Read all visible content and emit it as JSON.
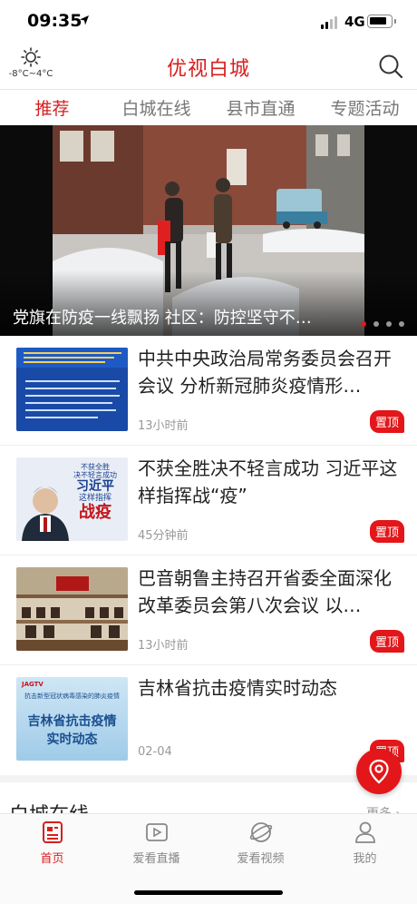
{
  "status_bar": {
    "time": "09:35",
    "network": "4G"
  },
  "header": {
    "weather_temp": "-8°C~4°C",
    "title": "优视白城"
  },
  "tabs": [
    {
      "label": "推荐",
      "active": true
    },
    {
      "label": "白城在线",
      "active": false
    },
    {
      "label": "县市直通",
      "active": false
    },
    {
      "label": "专题活动",
      "active": false
    }
  ],
  "banner": {
    "caption": "党旗在防疫一线飘扬 社区：防控坚守不…",
    "page_count": 4,
    "active_page": 1
  },
  "news": [
    {
      "title": "中共中央政治局常务委员会召开会议 分析新冠肺炎疫情形…",
      "time": "13小时前",
      "badge": "置顶"
    },
    {
      "title": "不获全胜决不轻言成功 习近平这样指挥战“疫”",
      "time": "45分钟前",
      "badge": "置顶"
    },
    {
      "title": "巴音朝鲁主持召开省委全面深化改革委员会第八次会议 以…",
      "time": "13小时前",
      "badge": "置顶"
    },
    {
      "title": "吉林省抗击疫情实时动态",
      "time": "02-04",
      "badge": "置顶"
    }
  ],
  "thumb_text": {
    "t2_line1": "不获全胜",
    "t2_line2": "决不轻言成功",
    "t2_name": "习近平",
    "t2_line3": "这样指挥",
    "t2_big": "战疫",
    "t4_top": "抗击新型冠状病毒感染的肺炎疫情",
    "t4_big1": "吉林省抗击疫情",
    "t4_big2": "实时动态"
  },
  "section": {
    "name": "白城在线",
    "more": "更多"
  },
  "bottom_nav": [
    {
      "label": "首页",
      "icon": "home-news-icon",
      "active": true
    },
    {
      "label": "爱看直播",
      "icon": "live-icon",
      "active": false
    },
    {
      "label": "爱看视频",
      "icon": "video-icon",
      "active": false
    },
    {
      "label": "我的",
      "icon": "user-icon",
      "active": false
    }
  ],
  "colors": {
    "brand": "#d81e1e",
    "badge": "#e3161a"
  }
}
